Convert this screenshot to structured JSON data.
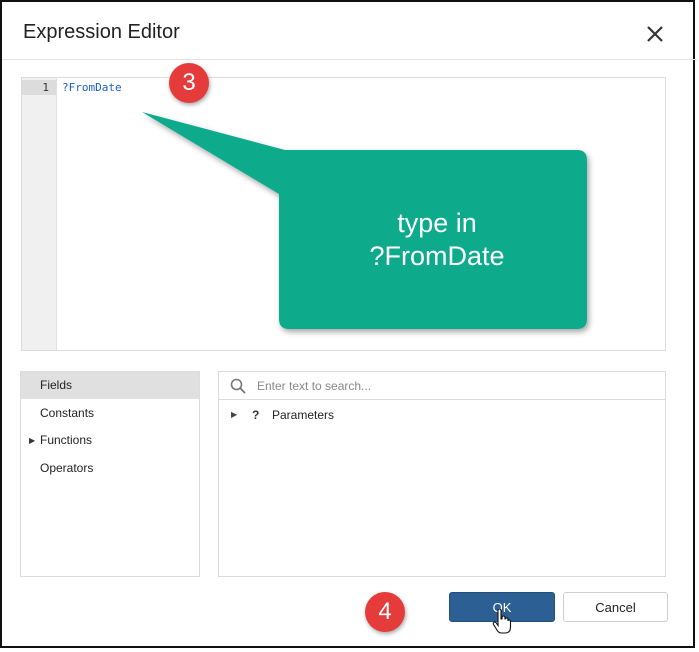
{
  "dialog": {
    "title": "Expression Editor",
    "close_icon": "close-icon"
  },
  "editor": {
    "line_number": "1",
    "code": "?FromDate"
  },
  "annotations": {
    "callout_line1": "type in",
    "callout_line2": "?FromDate",
    "callout_color": "#0aaa8c",
    "step3": "3",
    "step4": "4",
    "badge_color": "#e53b3b"
  },
  "categories": [
    {
      "label": "Fields",
      "selected": true,
      "expandable": false
    },
    {
      "label": "Constants",
      "selected": false,
      "expandable": false
    },
    {
      "label": "Functions",
      "selected": false,
      "expandable": true
    },
    {
      "label": "Operators",
      "selected": false,
      "expandable": false
    }
  ],
  "search": {
    "placeholder": "Enter text to search...",
    "value": ""
  },
  "tree": {
    "items": [
      {
        "label": "Parameters",
        "icon": "question-icon",
        "icon_glyph": "?"
      }
    ]
  },
  "buttons": {
    "ok_label": "OK",
    "cancel_label": "Cancel",
    "ok_color": "#2c5f93"
  }
}
